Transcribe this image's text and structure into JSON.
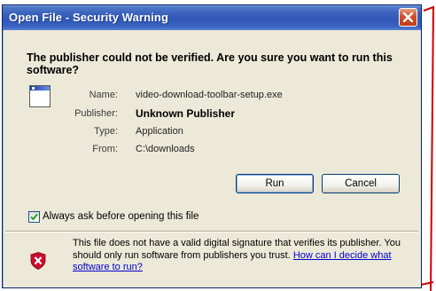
{
  "window": {
    "title": "Open File - Security Warning"
  },
  "dialog": {
    "question": "The publisher could not be verified.  Are you sure you want to run this software?",
    "fields": [
      {
        "label": "Name:",
        "value": "video-download-toolbar-setup.exe"
      },
      {
        "label": "Publisher:",
        "value": "Unknown Publisher"
      },
      {
        "label": "Type:",
        "value": "Application"
      },
      {
        "label": "From:",
        "value": "C:\\downloads"
      }
    ],
    "buttons": {
      "run": "Run",
      "cancel": "Cancel"
    },
    "checkbox": {
      "label": "Always ask before opening this file",
      "checked": true
    },
    "warning": {
      "text": "This file does not have a valid digital signature that verifies its publisher. You should only run software from publishers you trust.",
      "link_text": "How can I decide what software to run?"
    }
  },
  "icons": {
    "close": "close-icon",
    "app": "application-icon",
    "check": "checkmark-icon",
    "shield": "shield-warning-icon"
  },
  "colors": {
    "titlebar": "#3057b8",
    "dialog_bg": "#ece9d8",
    "close_button": "#d2502a",
    "link": "#0000cc",
    "annotation": "#d20000"
  }
}
